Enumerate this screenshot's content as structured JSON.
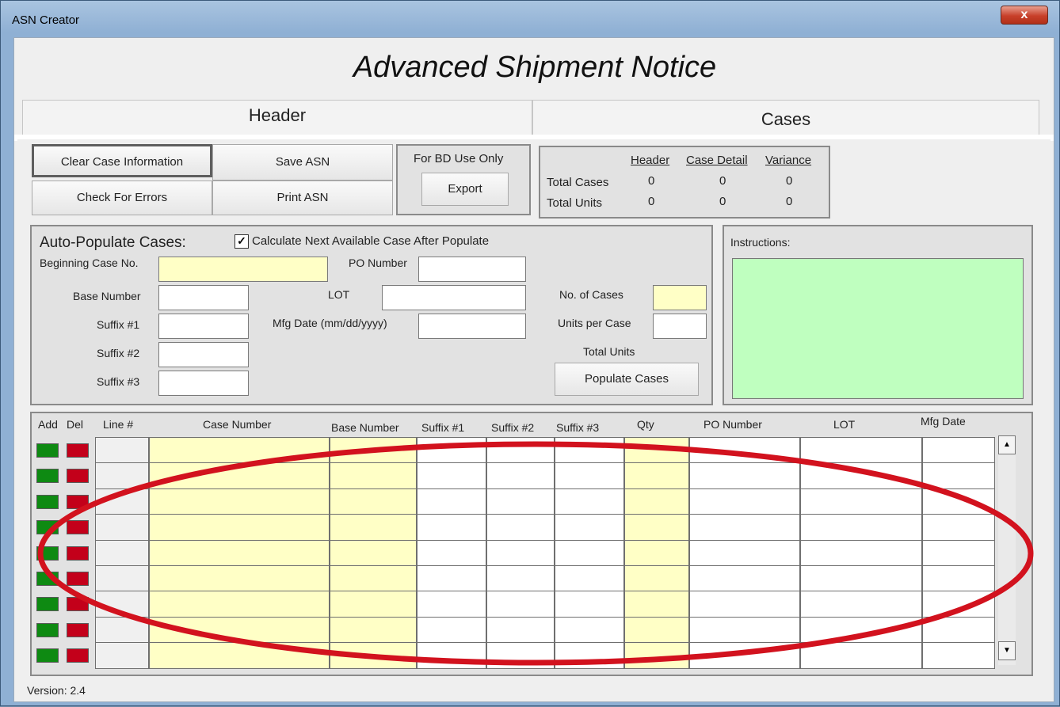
{
  "window": {
    "title": "ASN Creator",
    "close_glyph": "x"
  },
  "main_title": "Advanced Shipment Notice",
  "tabs": [
    {
      "label": "Header"
    },
    {
      "label": "Cases"
    }
  ],
  "actions": {
    "clear": "Clear Case Information",
    "save": "Save ASN",
    "check": "Check For Errors",
    "print": "Print ASN"
  },
  "bd": {
    "label": "For BD Use Only",
    "export": "Export"
  },
  "summary": {
    "col_header": "Header",
    "col_case_detail": "Case Detail",
    "col_variance": "Variance",
    "row_cases": "Total Cases",
    "row_units": "Total Units",
    "cases": [
      "0",
      "0",
      "0"
    ],
    "units": [
      "0",
      "0",
      "0"
    ]
  },
  "autopop": {
    "title": "Auto-Populate Cases:",
    "calc_label": "Calculate Next Available Case After Populate",
    "calc_checked": true,
    "beginning_case": "Beginning Case No.",
    "po_number": "PO Number",
    "base_number": "Base Number",
    "lot": "LOT",
    "suffix1": "Suffix #1",
    "mfg_date": "Mfg Date (mm/dd/yyyy)",
    "suffix2": "Suffix #2",
    "suffix3": "Suffix #3",
    "no_cases": "No. of Cases",
    "units_per_case": "Units per Case",
    "total_units": "Total Units",
    "populate": "Populate Cases"
  },
  "instructions": {
    "label": "Instructions:"
  },
  "grid": {
    "headers": {
      "add": "Add",
      "del": "Del",
      "line": "Line #",
      "case": "Case Number",
      "base": "Base Number",
      "s1": "Suffix #1",
      "s2": "Suffix #2",
      "s3": "Suffix #3",
      "qty": "Qty",
      "po": "PO Number",
      "lot": "LOT",
      "mfg": "Mfg Date"
    },
    "row_count": 9
  },
  "version": "Version: 2.4",
  "colors": {
    "add": "#0e8a12",
    "del": "#c3001a",
    "input_yellow": "#ffffc6",
    "instructions_bg": "#bfffbf",
    "annotation": "#d2121e"
  }
}
